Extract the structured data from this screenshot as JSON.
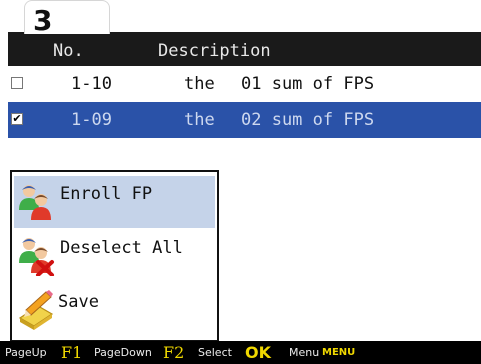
{
  "step_number": "3",
  "header": {
    "col_no": "No.",
    "col_description": "Description"
  },
  "rows": [
    {
      "checked": false,
      "checkbox_glyph": "",
      "no": "1-10",
      "the": "the",
      "description": "01 sum of FPS"
    },
    {
      "checked": true,
      "checkbox_glyph": "✔",
      "no": "1-09",
      "the": "the",
      "description": "02 sum of FPS"
    }
  ],
  "popup_menu": {
    "items": [
      {
        "label": "Enroll FP",
        "icon": "enroll-users-icon",
        "active": true
      },
      {
        "label": "Deselect All",
        "icon": "deselect-users-icon",
        "active": false
      },
      {
        "label": "Save",
        "icon": "save-pencil-icon",
        "active": false
      }
    ]
  },
  "footer": {
    "pageup_label": "PageUp",
    "pageup_key": "F1",
    "pagedown_label": "PageDown",
    "pagedown_key": "F2",
    "select_label": "Select",
    "select_key": "OK",
    "menu_label": "Menu",
    "menu_key": "MENU"
  },
  "colors": {
    "selected_row": "#2a52a8",
    "popup_highlight": "#c5d3e9",
    "key_accent": "#f0d800"
  }
}
